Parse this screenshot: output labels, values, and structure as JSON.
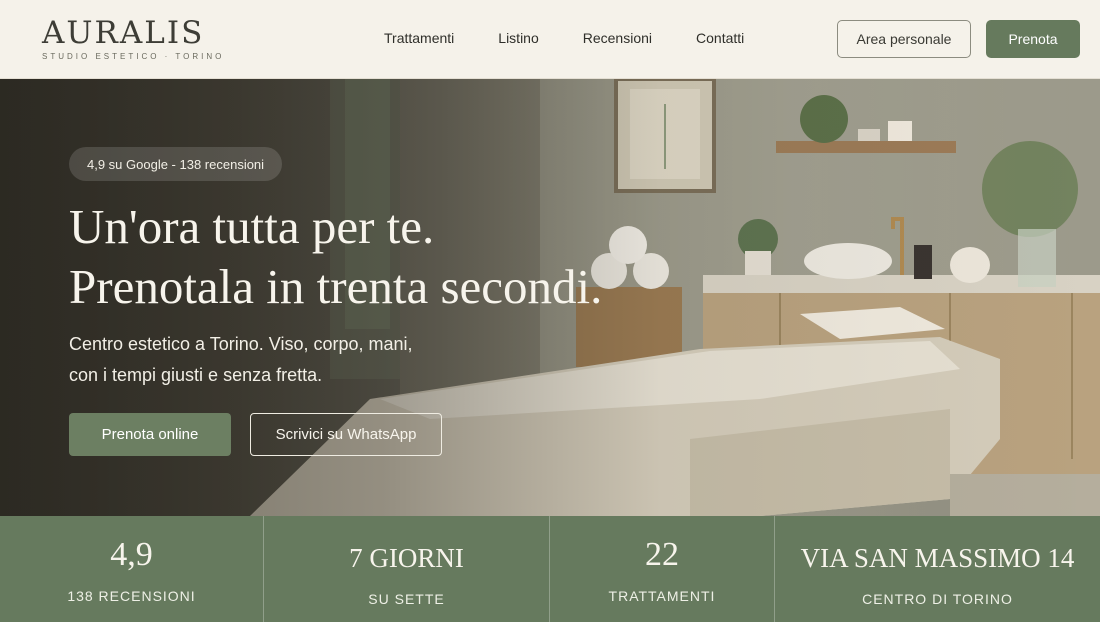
{
  "brand": {
    "name": "AURALIS",
    "tagline": "STUDIO ESTETICO · TORINO"
  },
  "nav": {
    "items": [
      "Trattamenti",
      "Listino",
      "Recensioni",
      "Contatti"
    ]
  },
  "header": {
    "area_label": "Area personale",
    "book_label": "Prenota"
  },
  "hero": {
    "badge": "4,9 su Google - 138 recensioni",
    "title_line1": "Un'ora tutta per te.",
    "title_line2": "Prenotala in trenta secondi.",
    "text_line1": "Centro estetico a Torino. Viso, corpo, mani,",
    "text_line2": "con i tempi giusti e senza fretta.",
    "primary_cta": "Prenota online",
    "secondary_cta": "Scrivici su WhatsApp"
  },
  "stats": [
    {
      "value": "4,9",
      "label": "138 RECENSIONI"
    },
    {
      "value": "7 GIORNI",
      "label": "SU SETTE"
    },
    {
      "value": "22",
      "label": "TRATTAMENTI"
    },
    {
      "value": "VIA SAN MASSIMO 14",
      "label": "CENTRO DI TORINO"
    }
  ],
  "colors": {
    "accent": "#667a5d",
    "header_bg": "#f5f2ea",
    "stats_bg": "#667a5e"
  }
}
